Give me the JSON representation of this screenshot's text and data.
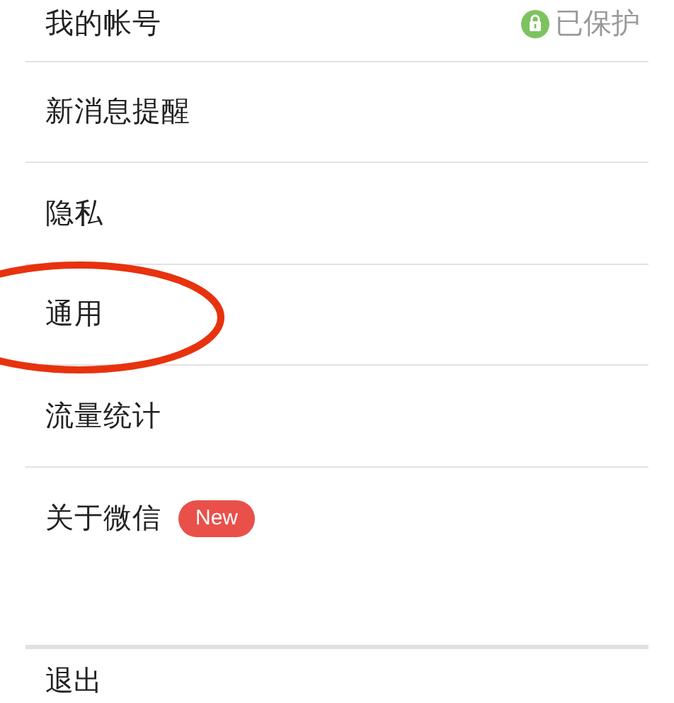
{
  "settings": [
    {
      "label": "我的帐号",
      "status": "已保护"
    },
    {
      "label": "新消息提醒"
    },
    {
      "label": "隐私"
    },
    {
      "label": "通用",
      "annotated": true
    },
    {
      "label": "流量统计"
    },
    {
      "label": "关于微信",
      "badge": "New"
    }
  ],
  "logout": {
    "label": "退出"
  }
}
